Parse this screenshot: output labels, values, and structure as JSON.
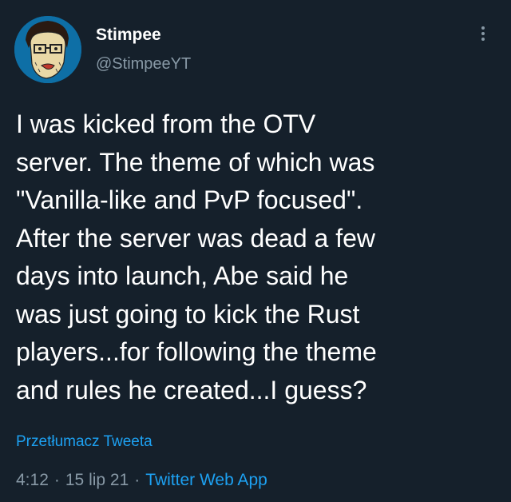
{
  "author": {
    "display_name": "Stimpee",
    "handle": "@StimpeeYT",
    "avatar_icon": "cartoon-face-avatar"
  },
  "tweet": {
    "text": "I was kicked from the OTV\nserver. The theme of which was\n\"Vanilla-like and PvP focused\".\nAfter the server was dead a few\ndays into launch, Abe said he\nwas just going to kick the Rust\nplayers...for following the theme\nand rules he created...I guess?",
    "translate_label": "Przetłumacz Tweeta"
  },
  "meta": {
    "time": "4:12",
    "separator": "·",
    "date": "15 lip 21",
    "source": "Twitter Web App"
  },
  "colors": {
    "background": "#15202b",
    "text": "#ffffff",
    "secondary": "#8899a6",
    "accent": "#1da1f2"
  },
  "icons": {
    "more": "vertical-ellipsis-icon"
  }
}
